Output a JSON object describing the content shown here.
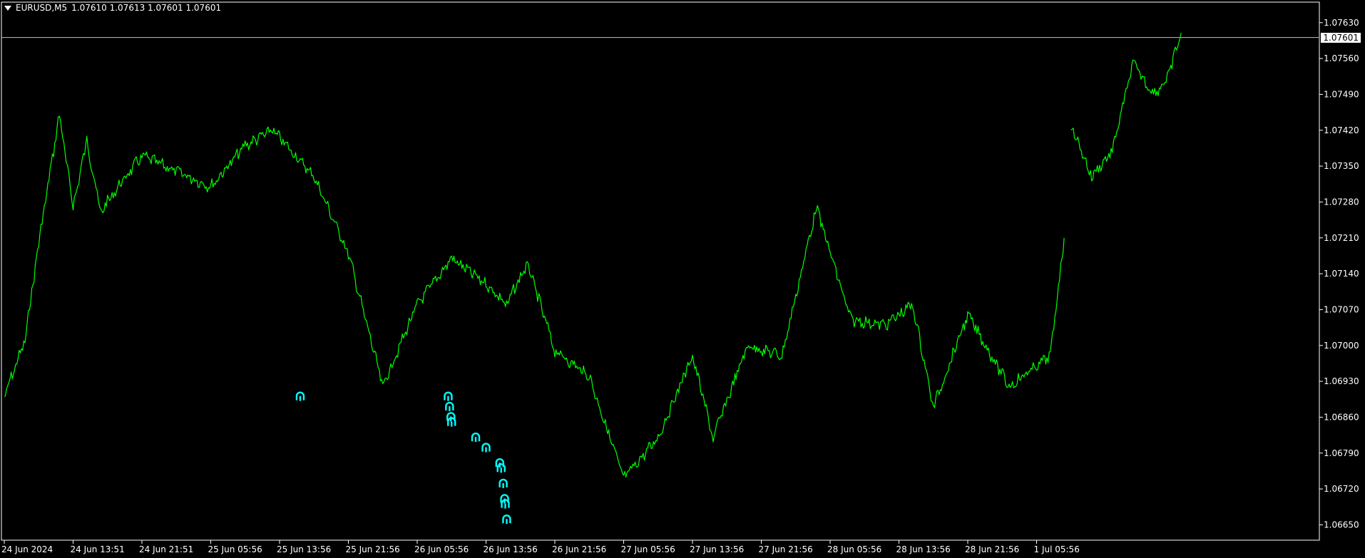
{
  "header": {
    "symbol": "EURUSD,M5",
    "ohlc": "1.07610 1.07613 1.07601 1.07601"
  },
  "colors": {
    "background": "#000000",
    "price_line": "#00ff00",
    "axis": "#ffffff",
    "current_price_line": "#c0c0c0",
    "arrow_marker": "#00ffff"
  },
  "chart_data": {
    "type": "line",
    "symbol": "EURUSD",
    "timeframe": "M5",
    "current_price": 1.07601,
    "current_price_label": "1.07601",
    "ylim": [
      1.0662,
      1.0767
    ],
    "y_ticks": [
      "1.07630",
      "1.07560",
      "1.07490",
      "1.07420",
      "1.07350",
      "1.07280",
      "1.07210",
      "1.07140",
      "1.07070",
      "1.07000",
      "1.06930",
      "1.06860",
      "1.06790",
      "1.06720",
      "1.06650"
    ],
    "x_ticks": [
      "24 Jun 2024",
      "24 Jun 13:51",
      "24 Jun 21:51",
      "25 Jun 05:56",
      "25 Jun 13:56",
      "25 Jun 21:56",
      "26 Jun 05:56",
      "26 Jun 13:56",
      "26 Jun 21:56",
      "27 Jun 05:56",
      "27 Jun 13:56",
      "27 Jun 21:56",
      "28 Jun 05:56",
      "28 Jun 13:56",
      "28 Jun 21:56",
      "1 Jul 05:56"
    ],
    "series": [
      {
        "x": [
          0,
          0.3,
          0.5,
          0.8,
          1,
          1.2,
          1.4,
          1.6,
          2,
          2.5,
          3,
          3.5,
          3.9,
          4.5,
          5,
          5.5,
          6,
          6.5,
          7,
          7.3,
          7.6,
          8,
          8.5,
          9,
          9.5,
          10,
          10.3,
          10.8,
          11.3,
          11.8,
          12.3,
          12.8,
          13.2,
          13.5,
          14,
          14.6,
          15.2,
          15.4
        ],
        "y": [
          1.069,
          1.0701,
          1.072,
          1.0745,
          1.0727,
          1.074,
          1.0726,
          1.073,
          1.0737,
          1.0734,
          1.0731,
          1.0739,
          1.0742,
          1.0733,
          1.0718,
          1.0692,
          1.0708,
          1.0717,
          1.0712,
          1.0708,
          1.0716,
          1.0699,
          1.0694,
          1.0674,
          1.0682,
          1.0698,
          1.0682,
          1.07,
          1.0698,
          1.0727,
          1.0705,
          1.0704,
          1.0708,
          1.0688,
          1.0706,
          1.0692,
          1.0698,
          1.0721
        ]
      },
      {
        "x": [
          15.5,
          15.8,
          16.1,
          16.4,
          16.7,
          16.9,
          17.1
        ],
        "y": [
          1.0743,
          1.0733,
          1.0738,
          1.0755,
          1.0749,
          1.0752,
          1.0761
        ]
      }
    ],
    "arrow_markers": [
      {
        "x": 4.3,
        "y": 1.069
      },
      {
        "x": 6.45,
        "y": 1.069
      },
      {
        "x": 6.47,
        "y": 1.0688
      },
      {
        "x": 6.49,
        "y": 1.0686
      },
      {
        "x": 6.5,
        "y": 1.0685
      },
      {
        "x": 6.85,
        "y": 1.0682
      },
      {
        "x": 7.0,
        "y": 1.068
      },
      {
        "x": 7.2,
        "y": 1.0677
      },
      {
        "x": 7.22,
        "y": 1.0676
      },
      {
        "x": 7.25,
        "y": 1.0673
      },
      {
        "x": 7.27,
        "y": 1.067
      },
      {
        "x": 7.28,
        "y": 1.0669
      },
      {
        "x": 7.3,
        "y": 1.0666
      }
    ]
  }
}
